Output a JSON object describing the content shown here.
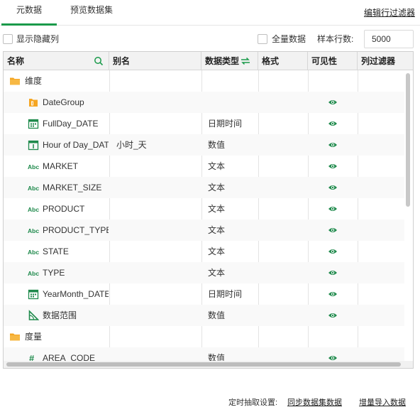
{
  "tabs": {
    "metadata": "元数据",
    "preview": "预览数据集"
  },
  "edit_filter": "编辑行过滤器",
  "toolbar": {
    "show_hidden": "显示隐藏列",
    "full_data": "全量数据",
    "sample_label": "样本行数:",
    "sample_value": "5000"
  },
  "columns": {
    "name": "名称",
    "alias": "别名",
    "type": "数据类型",
    "format": "格式",
    "visible": "可见性",
    "filter": "列过滤器"
  },
  "rows": [
    {
      "name": "维度",
      "alias": "",
      "type": "",
      "icon": "folder-icon",
      "visible": false
    },
    {
      "name": "DateGroup",
      "alias": "",
      "type": "",
      "icon": "date-group-icon",
      "visible": true
    },
    {
      "name": "FullDay_DATE",
      "alias": "",
      "type": "日期时间",
      "icon": "calendar-icon",
      "visible": true
    },
    {
      "name": "Hour of Day_DATE",
      "alias": "小时_天",
      "type": "数值",
      "icon": "calendar-number-icon",
      "visible": true
    },
    {
      "name": "MARKET",
      "alias": "",
      "type": "文本",
      "icon": "text-abc-icon",
      "visible": true
    },
    {
      "name": "MARKET_SIZE",
      "alias": "",
      "type": "文本",
      "icon": "text-abc-icon",
      "visible": true
    },
    {
      "name": "PRODUCT",
      "alias": "",
      "type": "文本",
      "icon": "text-abc-icon",
      "visible": true
    },
    {
      "name": "PRODUCT_TYPE",
      "alias": "",
      "type": "文本",
      "icon": "text-abc-icon",
      "visible": true
    },
    {
      "name": "STATE",
      "alias": "",
      "type": "文本",
      "icon": "text-abc-icon",
      "visible": true
    },
    {
      "name": "TYPE",
      "alias": "",
      "type": "文本",
      "icon": "text-abc-icon",
      "visible": true
    },
    {
      "name": "YearMonth_DATE",
      "alias": "",
      "type": "日期时间",
      "icon": "calendar-icon",
      "visible": true
    },
    {
      "name": "数据范围",
      "alias": "",
      "type": "数值",
      "icon": "range-triangle-icon",
      "visible": true
    },
    {
      "name": "度量",
      "alias": "",
      "type": "",
      "icon": "folder-icon",
      "visible": false
    },
    {
      "name": "AREA_CODE",
      "alias": "",
      "type": "数值",
      "icon": "number-hash-icon",
      "visible": true
    }
  ],
  "footer": {
    "schedule_label": "定时抽取设置:",
    "sync_link": "同步数据集数据",
    "increment_link": "增量导入数据"
  },
  "colors": {
    "accent": "#1a9a4a",
    "folder": "#f5a623",
    "icon_green": "#1f8a4c"
  }
}
